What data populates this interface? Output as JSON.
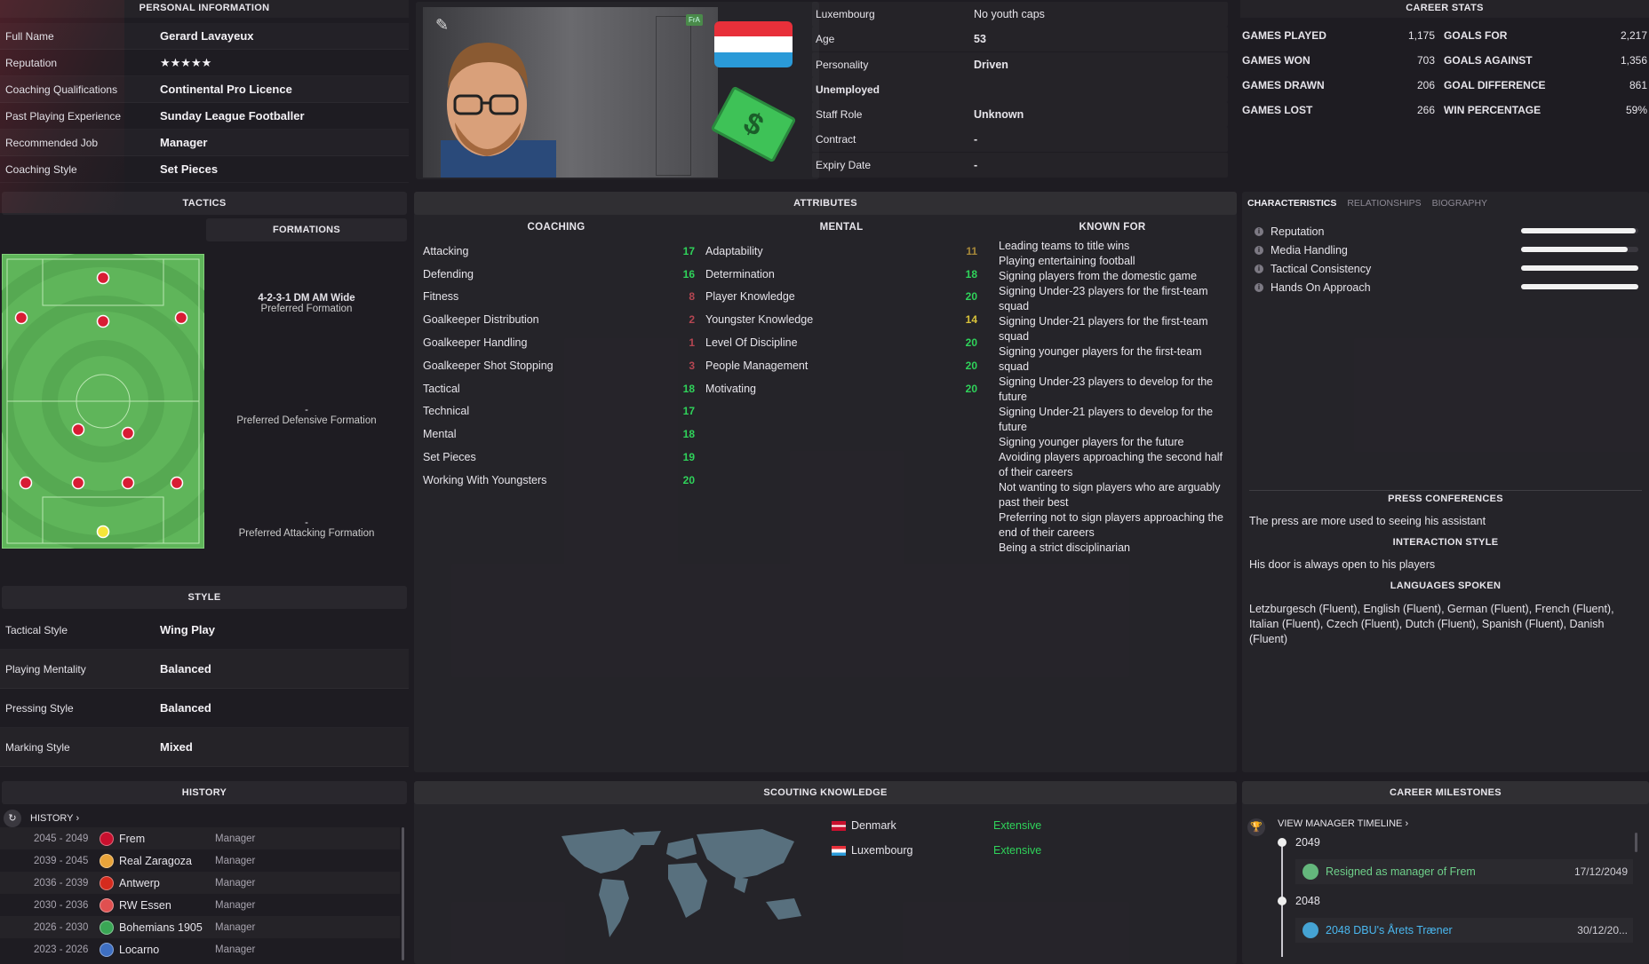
{
  "personal": {
    "header": "PERSONAL INFORMATION",
    "rows": [
      {
        "label": "Full Name",
        "value": "Gerard Lavayeux"
      },
      {
        "label": "Reputation",
        "value": "★★★★★"
      },
      {
        "label": "Coaching Qualifications",
        "value": "Continental Pro Licence"
      },
      {
        "label": "Past Playing Experience",
        "value": "Sunday League Footballer"
      },
      {
        "label": "Recommended Job",
        "value": "Manager"
      },
      {
        "label": "Coaching Style",
        "value": "Set Pieces"
      }
    ]
  },
  "profile": {
    "badge": "FrA"
  },
  "details": {
    "rows": [
      {
        "label": "Luxembourg",
        "value": "No youth caps",
        "bold": false
      },
      {
        "label": "Age",
        "value": "53",
        "bold": true
      },
      {
        "label": "Personality",
        "value": "Driven",
        "bold": true
      },
      {
        "label": "Unemployed",
        "value": "",
        "bold": true
      },
      {
        "label": "Staff Role",
        "value": "Unknown",
        "bold": true
      },
      {
        "label": "Contract",
        "value": "-",
        "bold": true
      },
      {
        "label": "Expiry Date",
        "value": "-",
        "bold": true
      }
    ]
  },
  "career_stats": {
    "header": "CAREER STATS",
    "left": [
      {
        "label": "GAMES PLAYED",
        "value": "1,175"
      },
      {
        "label": "GAMES WON",
        "value": "703"
      },
      {
        "label": "GAMES DRAWN",
        "value": "206"
      },
      {
        "label": "GAMES LOST",
        "value": "266"
      }
    ],
    "right": [
      {
        "label": "GOALS FOR",
        "value": "2,217"
      },
      {
        "label": "GOALS AGAINST",
        "value": "1,356"
      },
      {
        "label": "GOAL DIFFERENCE",
        "value": "861"
      },
      {
        "label": "WIN PERCENTAGE",
        "value": "59%"
      }
    ]
  },
  "tactics": {
    "header": "TACTICS",
    "formations_header": "FORMATIONS",
    "preferred": {
      "name": "4-2-3-1 DM AM Wide",
      "label": "Preferred Formation"
    },
    "defensive": {
      "name": "-",
      "label": "Preferred Defensive Formation"
    },
    "attacking": {
      "name": "-",
      "label": "Preferred Attacking Formation"
    }
  },
  "style": {
    "header": "STYLE",
    "rows": [
      {
        "label": "Tactical Style",
        "value": "Wing Play"
      },
      {
        "label": "Playing Mentality",
        "value": "Balanced"
      },
      {
        "label": "Pressing Style",
        "value": "Balanced"
      },
      {
        "label": "Marking Style",
        "value": "Mixed"
      }
    ]
  },
  "attributes": {
    "header": "ATTRIBUTES",
    "coaching_header": "COACHING",
    "coaching": [
      {
        "name": "Attacking",
        "value": "17",
        "c": "g"
      },
      {
        "name": "Defending",
        "value": "16",
        "c": "g"
      },
      {
        "name": "Fitness",
        "value": "8",
        "c": "r"
      },
      {
        "name": "Goalkeeper Distribution",
        "value": "2",
        "c": "r"
      },
      {
        "name": "Goalkeeper Handling",
        "value": "1",
        "c": "r"
      },
      {
        "name": "Goalkeeper Shot Stopping",
        "value": "3",
        "c": "r"
      },
      {
        "name": "Tactical",
        "value": "18",
        "c": "g"
      },
      {
        "name": "Technical",
        "value": "17",
        "c": "g"
      },
      {
        "name": "Mental",
        "value": "18",
        "c": "g"
      },
      {
        "name": "Set Pieces",
        "value": "19",
        "c": "g"
      },
      {
        "name": "Working With Youngsters",
        "value": "20",
        "c": "g"
      }
    ],
    "mental_header": "MENTAL",
    "mental": [
      {
        "name": "Adaptability",
        "value": "11",
        "c": "o"
      },
      {
        "name": "Determination",
        "value": "18",
        "c": "g"
      },
      {
        "name": "Player Knowledge",
        "value": "20",
        "c": "g"
      },
      {
        "name": "Youngster Knowledge",
        "value": "14",
        "c": "y"
      },
      {
        "name": "Level Of Discipline",
        "value": "20",
        "c": "g"
      },
      {
        "name": "People Management",
        "value": "20",
        "c": "g"
      },
      {
        "name": "Motivating",
        "value": "20",
        "c": "g"
      }
    ],
    "known_for_header": "KNOWN FOR",
    "known_for": [
      "Leading teams to title wins",
      "Playing entertaining football",
      "Signing players from the domestic game",
      "Signing Under-23 players for the first-team squad",
      "Signing Under-21 players for the first-team squad",
      "Signing younger players for the first-team squad",
      "Signing Under-23 players to develop for the future",
      "Signing Under-21 players to develop for the future",
      "Signing younger players for the future",
      "Avoiding players approaching the second half of their careers",
      "Not wanting to sign players who are arguably past their best",
      "Preferring not to sign players approaching the end of their careers",
      "Being a strict disciplinarian"
    ]
  },
  "characteristics": {
    "tabs": [
      "CHARACTERISTICS",
      "RELATIONSHIPS",
      "BIOGRAPHY"
    ],
    "items": [
      {
        "label": "Reputation",
        "level": 0.98
      },
      {
        "label": "Media Handling",
        "level": 0.91
      },
      {
        "label": "Tactical Consistency",
        "level": 1.0
      },
      {
        "label": "Hands On Approach",
        "level": 1.0
      }
    ],
    "press_header": "PRESS CONFERENCES",
    "press_text": "The press are more used to seeing his assistant",
    "interaction_header": "INTERACTION STYLE",
    "interaction_text": "His door is always open to his players",
    "languages_header": "LANGUAGES SPOKEN",
    "languages_text": "Letzburgesch (Fluent), English (Fluent), German (Fluent), French (Fluent), Italian (Fluent), Czech (Fluent), Dutch (Fluent), Spanish (Fluent), Danish (Fluent)"
  },
  "history": {
    "header": "HISTORY",
    "link": "HISTORY",
    "rows": [
      {
        "years": "2045 - 2049",
        "club": "Frem",
        "role": "Manager",
        "color": "#c8102e"
      },
      {
        "years": "2039 - 2045",
        "club": "Real Zaragoza",
        "role": "Manager",
        "color": "#e8a33a"
      },
      {
        "years": "2036 - 2039",
        "club": "Antwerp",
        "role": "Manager",
        "color": "#d52b1e"
      },
      {
        "years": "2030 - 2036",
        "club": "RW Essen",
        "role": "Manager",
        "color": "#e05050"
      },
      {
        "years": "2026 - 2030",
        "club": "Bohemians 1905",
        "role": "Manager",
        "color": "#3aa655"
      },
      {
        "years": "2023 - 2026",
        "club": "Locarno",
        "role": "Manager",
        "color": "#3e6fc2"
      }
    ]
  },
  "scouting": {
    "header": "SCOUTING KNOWLEDGE",
    "rows": [
      {
        "country": "Denmark",
        "level": "Extensive"
      },
      {
        "country": "Luxembourg",
        "level": "Extensive"
      }
    ]
  },
  "milestones": {
    "header": "CAREER MILESTONES",
    "link": "VIEW MANAGER TIMELINE",
    "entries": [
      {
        "year": "2049",
        "text": "Resigned as manager of Frem",
        "date": "17/12/2049",
        "color": "#6fd08a"
      },
      {
        "year": "2048",
        "text": "2048 DBU's Årets Træner",
        "date": "30/12/20...",
        "color": "#4ab8f0"
      }
    ]
  }
}
